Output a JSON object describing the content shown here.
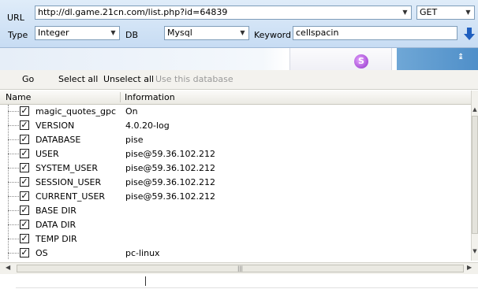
{
  "form": {
    "url_label": "URL",
    "url_value": "http://dl.game.21cn.com/list.php?id=64839",
    "method_value": "GET",
    "type_label": "Type",
    "type_value": "Integer",
    "db_label": "DB",
    "db_value": "Mysql",
    "keyword_label": "Keyword",
    "keyword_value": "cellspacin"
  },
  "toolbar": {
    "go": "Go",
    "select_all": "Select all",
    "unselect_all": "Unselect all",
    "use_db": "Use this database"
  },
  "grid": {
    "columns": [
      "Name",
      "Information"
    ],
    "rows": [
      {
        "name": "magic_quotes_gpc",
        "info": "On"
      },
      {
        "name": "VERSION",
        "info": "4.0.20-log"
      },
      {
        "name": "DATABASE",
        "info": "pise"
      },
      {
        "name": "USER",
        "info": "pise@59.36.102.212"
      },
      {
        "name": "SYSTEM_USER",
        "info": "pise@59.36.102.212"
      },
      {
        "name": "SESSION_USER",
        "info": "pise@59.36.102.212"
      },
      {
        "name": "CURRENT_USER",
        "info": "pise@59.36.102.212"
      },
      {
        "name": "BASE DIR",
        "info": ""
      },
      {
        "name": "DATA DIR",
        "info": ""
      },
      {
        "name": "TEMP DIR",
        "info": ""
      },
      {
        "name": "OS",
        "info": "pc-linux"
      }
    ]
  },
  "icons": {
    "dropdown": "chevron-down-icon",
    "go_arrow": "down-arrow-icon",
    "checkbox": "check-icon"
  },
  "colors": {
    "header_bg": "#c7dcf3",
    "go_arrow": "#1f5fbf"
  }
}
